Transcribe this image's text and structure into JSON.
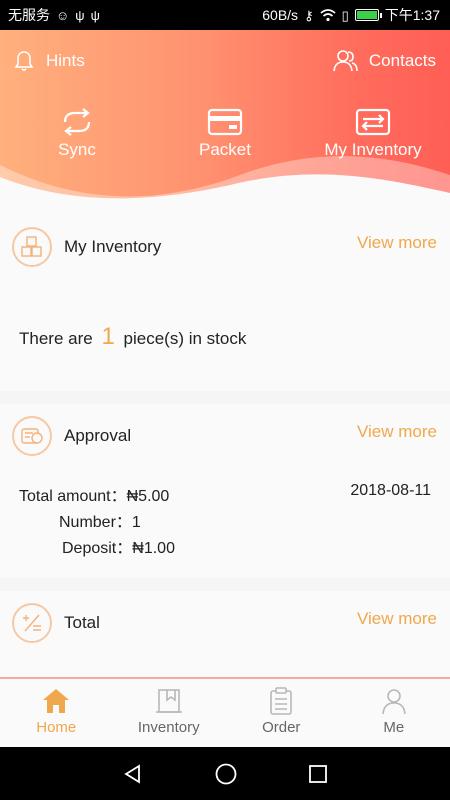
{
  "status_bar": {
    "carrier": "无服务",
    "speed": "60B/s",
    "time": "下午1:37"
  },
  "header": {
    "hints_label": "Hints",
    "contacts_label": "Contacts",
    "actions": [
      {
        "label": "Sync",
        "icon": "sync-icon"
      },
      {
        "label": "Packet",
        "icon": "wallet-icon"
      },
      {
        "label": "My Inventory",
        "icon": "transfer-icon"
      }
    ]
  },
  "inventory_card": {
    "title": "My Inventory",
    "view_more": "View more",
    "stock_prefix": "There are",
    "stock_count": "1",
    "stock_suffix": "piece(s) in stock"
  },
  "approval_card": {
    "title": "Approval",
    "view_more": "View more",
    "total_amount_label": "Total amount：",
    "total_amount_value": "₦5.00",
    "number_label": "Number：",
    "number_value": "1",
    "deposit_label": "Deposit：",
    "deposit_value": "₦1.00",
    "date": "2018-08-11"
  },
  "total_card": {
    "title": "Total",
    "view_more": "View more"
  },
  "bottom_nav": {
    "items": [
      {
        "label": "Home",
        "active": true
      },
      {
        "label": "Inventory"
      },
      {
        "label": "Order"
      },
      {
        "label": "Me"
      }
    ]
  },
  "colors": {
    "accent": "#f0a84c",
    "header_start": "#ffb07d",
    "header_end": "#ff5e55"
  }
}
